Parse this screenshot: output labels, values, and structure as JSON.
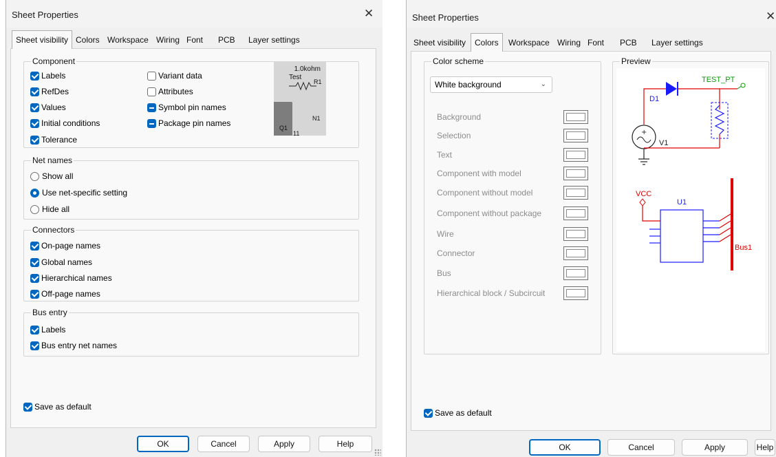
{
  "left_dialog": {
    "title": "Sheet Properties",
    "close_glyph": "✕",
    "tabs": [
      "Sheet visibility",
      "Colors",
      "Workspace",
      "Wiring",
      "Font",
      "PCB",
      "Layer settings"
    ],
    "active_tab": "Sheet visibility",
    "component": {
      "title": "Component",
      "left": [
        {
          "label": "Labels",
          "state": "checked"
        },
        {
          "label": "RefDes",
          "state": "checked"
        },
        {
          "label": "Values",
          "state": "checked"
        },
        {
          "label": "Initial conditions",
          "state": "checked"
        },
        {
          "label": "Tolerance",
          "state": "checked"
        }
      ],
      "right": [
        {
          "label": "Variant data",
          "state": "unchecked"
        },
        {
          "label": "Attributes",
          "state": "unchecked"
        },
        {
          "label": "Symbol pin names",
          "state": "mixed"
        },
        {
          "label": "Package pin names",
          "state": "mixed"
        }
      ],
      "preview": {
        "value": "1.0kohm",
        "label": "Test",
        "r_ref": "R1",
        "n_ref": "N1",
        "q_ref": "Q1",
        "pin": "11"
      }
    },
    "net_names": {
      "title": "Net names",
      "options": [
        "Show all",
        "Use net-specific setting",
        "Hide all"
      ],
      "selected": "Use net-specific setting"
    },
    "connectors": {
      "title": "Connectors",
      "items": [
        "On-page names",
        "Global names",
        "Hierarchical names",
        "Off-page names"
      ]
    },
    "bus_entry": {
      "title": "Bus entry",
      "items": [
        "Labels",
        "Bus entry net names"
      ]
    },
    "save_default": "Save as default",
    "buttons": {
      "ok": "OK",
      "cancel": "Cancel",
      "apply": "Apply",
      "help": "Help"
    }
  },
  "right_dialog": {
    "title": "Sheet Properties",
    "close_glyph": "✕",
    "tabs": [
      "Sheet visibility",
      "Colors",
      "Workspace",
      "Wiring",
      "Font",
      "PCB",
      "Layer settings"
    ],
    "active_tab": "Colors",
    "color_scheme": {
      "title": "Color scheme",
      "selected": "White background",
      "items": [
        "Background",
        "Selection",
        "Text",
        "Component with model",
        "Component without model",
        "Component without package",
        "Wire",
        "Connector",
        "Bus",
        "Hierarchical block / Subcircuit"
      ]
    },
    "preview": {
      "title": "Preview",
      "d1": "D1",
      "test_pt": "TEST_PT",
      "v1": "V1",
      "vcc": "VCC",
      "u1": "U1",
      "bus1": "Bus1"
    },
    "save_default": "Save as default",
    "buttons": {
      "ok": "OK",
      "cancel": "Cancel",
      "apply": "Apply",
      "help": "Help"
    }
  },
  "colors": {
    "accent": "#0067c0",
    "wire_red": "#e00000",
    "component_blue": "#1a1aff",
    "text_green": "#0a9a0a"
  }
}
